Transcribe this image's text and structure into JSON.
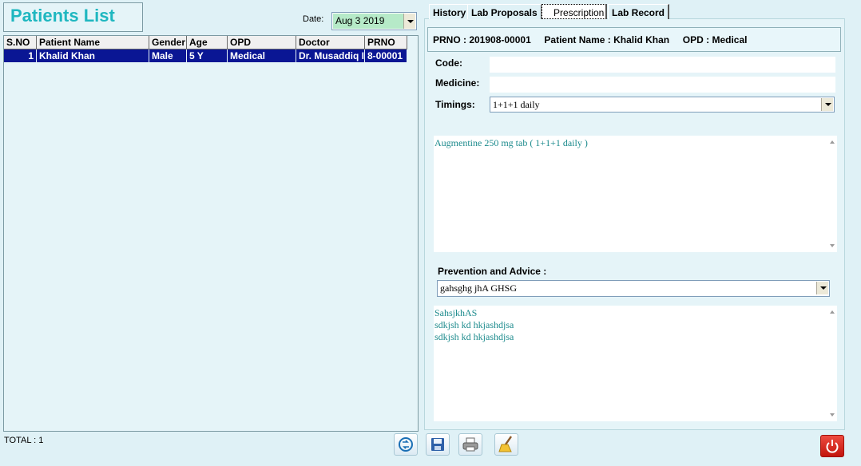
{
  "title": "Patients List",
  "date": {
    "label": "Date:",
    "value": "Aug  3  2019"
  },
  "grid": {
    "columns": [
      "S.NO",
      "Patient Name",
      "Gender",
      "Age",
      "OPD",
      "Doctor",
      "PRNO"
    ],
    "rows": [
      {
        "sno": "1",
        "name": "Khalid Khan",
        "gender": "Male",
        "age": "5 Y",
        "opd": "Medical",
        "doctor": "Dr. Musaddiq I",
        "prno": "8-00001"
      }
    ]
  },
  "total": "TOTAL : 1",
  "tabs": [
    "History",
    "Lab Proposals",
    "Prescription",
    "Lab Record"
  ],
  "info_bar": "PRNO : 201908-00001     Patient Name : Khalid Khan     OPD : Medical",
  "form": {
    "code_label": "Code:",
    "code_value": "",
    "medicine_label": "Medicine:",
    "medicine_value": "",
    "timings_label": "Timings:",
    "timings_value": "1+1+1 daily",
    "prescription_lines": [
      "Augmentine 250 mg tab       ( 1+1+1 daily )"
    ],
    "advice_label": "Prevention and Advice :",
    "advice_value": "gahsghg jhA GHSG",
    "advice_lines": [
      "SahsjkhAS",
      "sdkjsh kd hkjashdjsa",
      "sdkjsh kd hkjashdjsa"
    ]
  },
  "colors": {
    "accent": "#1fb7c0",
    "selection": "#0a1694",
    "background": "#dff1f6",
    "memo_text": "#1b8a8c"
  },
  "icons": [
    "refresh-icon",
    "save-icon",
    "print-icon",
    "clear-broom-icon",
    "power-icon"
  ]
}
